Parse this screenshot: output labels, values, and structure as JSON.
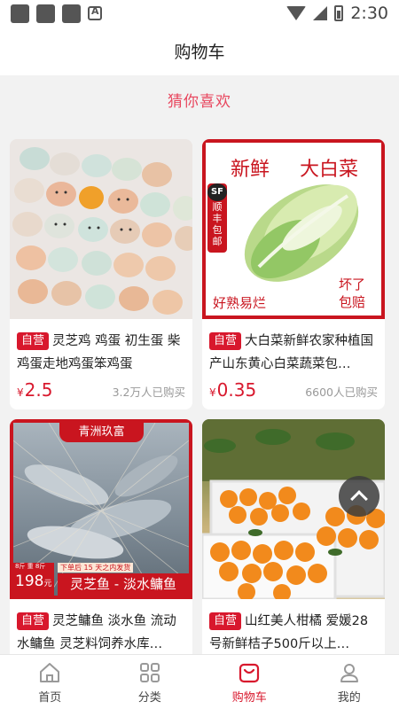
{
  "status": {
    "time": "2:30"
  },
  "header": {
    "title": "购物车"
  },
  "section": {
    "title": "猜你喜欢"
  },
  "products": [
    {
      "tag": "自营",
      "title": "灵芝鸡 鸡蛋 初生蛋 柴鸡蛋走地鸡蛋笨鸡蛋",
      "currency": "¥",
      "price": "2.5",
      "sold": "3.2万人已购买"
    },
    {
      "tag": "自营",
      "title": "大白菜新鲜农家种植国产山东黄心白菜蔬菜包…",
      "currency": "¥",
      "price": "0.35",
      "sold": "6600人已购买",
      "image_text": {
        "headline1": "新鲜",
        "headline2": "大白菜",
        "badge_sf": "SF",
        "badge_text": "顺丰包邮",
        "left": "好熟易烂",
        "right1": "坏了",
        "right2": "包赔"
      }
    },
    {
      "tag": "自营",
      "title": "灵芝鳙鱼 淡水鱼 流动水鳙鱼 灵芝料饲养水库…",
      "image_text": {
        "brand": "青洲玖富",
        "weight": "8斤 重 8斤",
        "price": "198",
        "unit": "元",
        "note": "下单后 15 天之内发货",
        "banner": "灵芝鱼 - 淡水鳙鱼"
      }
    },
    {
      "tag": "自营",
      "title": "山红美人柑橘 爱媛28号新鲜桔子500斤以上…"
    }
  ],
  "tabs": [
    {
      "label": "首页",
      "icon": "home-icon"
    },
    {
      "label": "分类",
      "icon": "category-icon"
    },
    {
      "label": "购物车",
      "icon": "cart-icon"
    },
    {
      "label": "我的",
      "icon": "user-icon"
    }
  ],
  "colors": {
    "accent": "#d8182d",
    "section_title": "#e8465e"
  }
}
